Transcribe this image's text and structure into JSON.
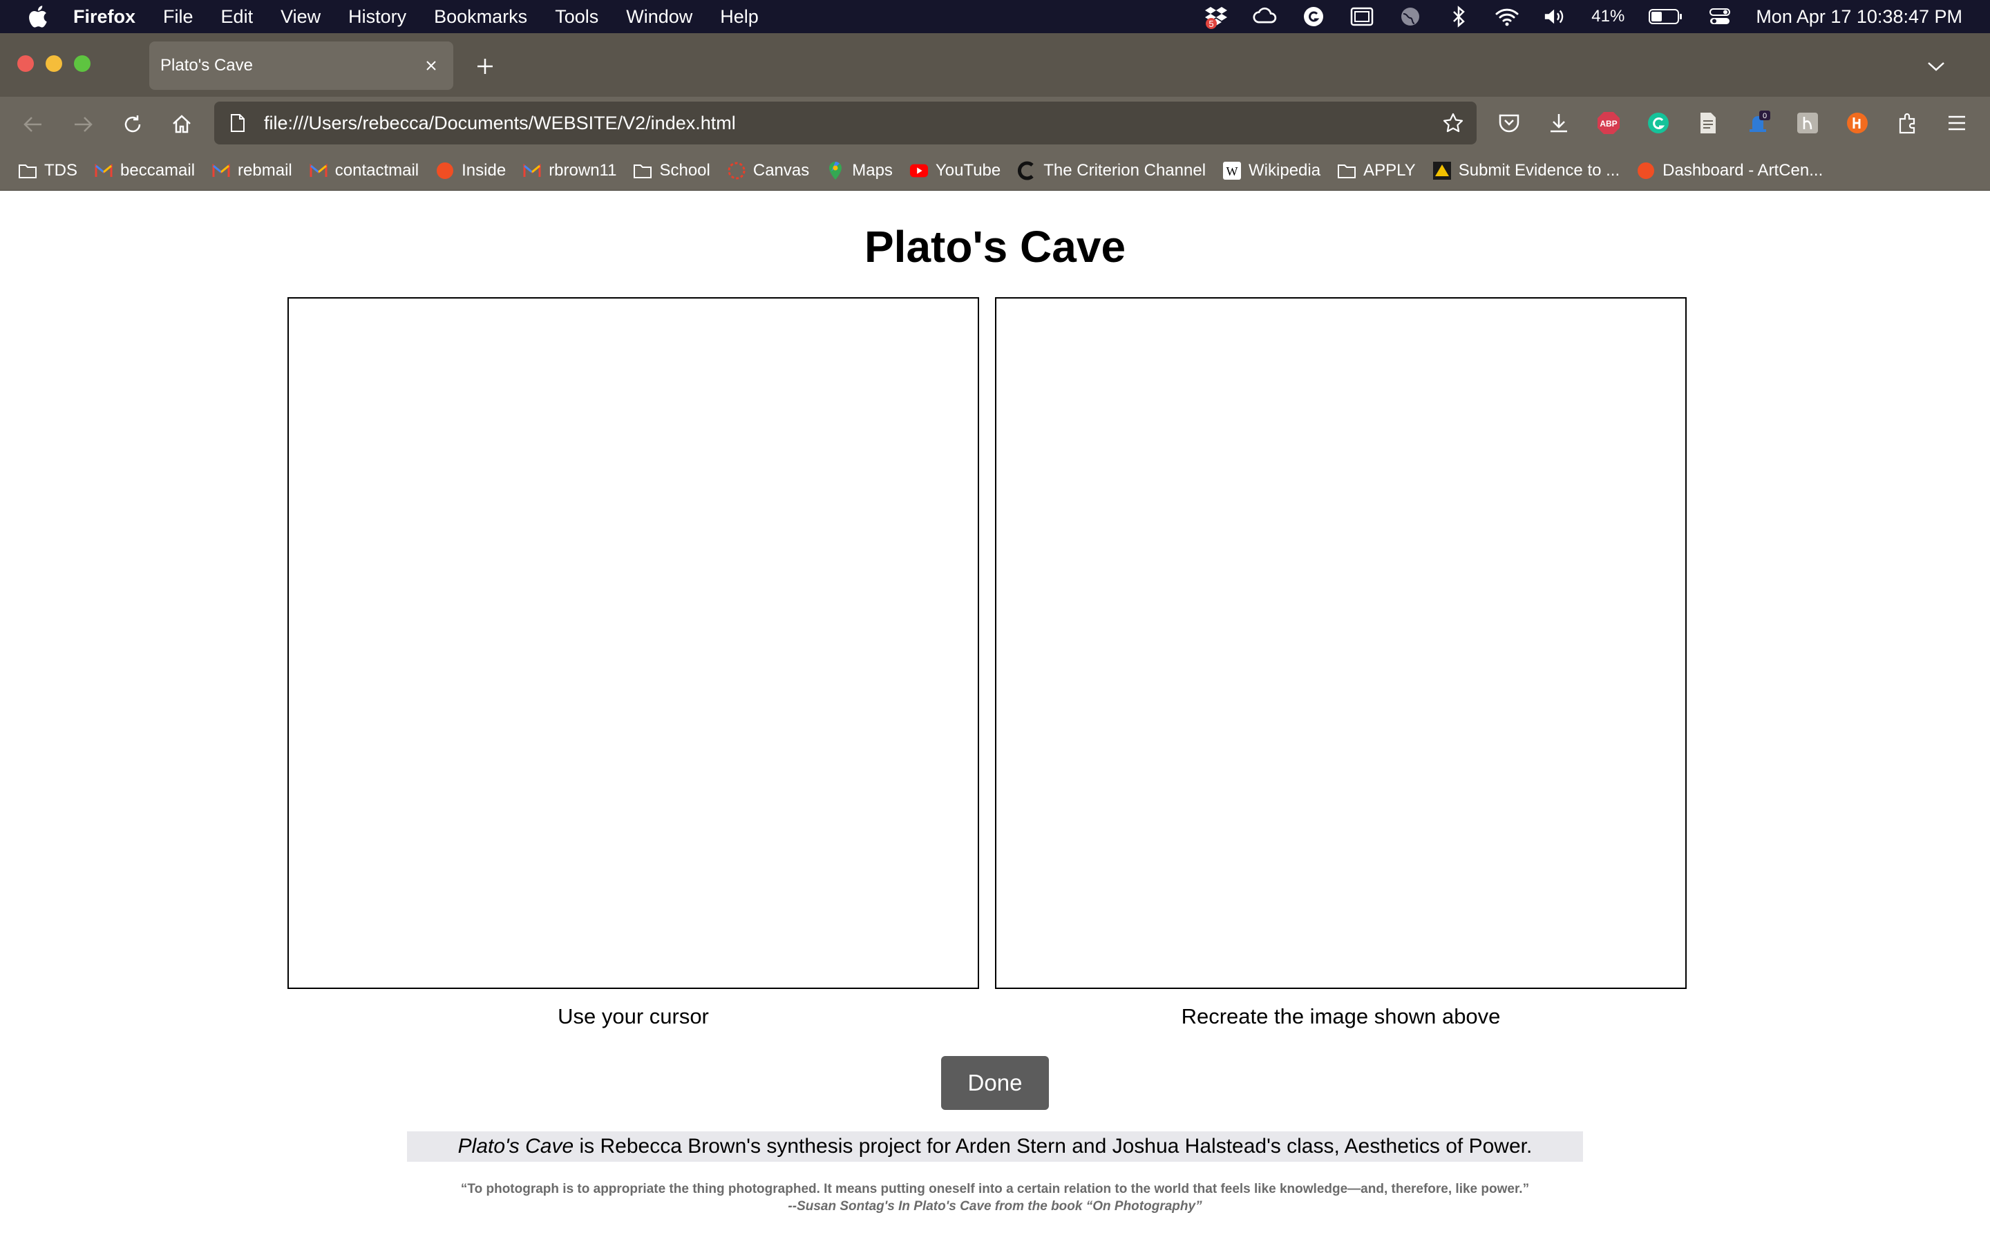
{
  "menubar": {
    "app_name": "Firefox",
    "items": [
      "File",
      "Edit",
      "View",
      "History",
      "Bookmarks",
      "Tools",
      "Window",
      "Help"
    ],
    "dropbox_badge": "5",
    "battery_percent": "41%",
    "clock": "Mon Apr 17  10:38:47 PM"
  },
  "browser": {
    "tab_title": "Plato's Cave",
    "url": "file:///Users/rebecca/Documents/WEBSITE/V2/index.html",
    "extension_badge": "0",
    "abp_label": "ABP",
    "bookmarks": [
      {
        "label": "TDS",
        "icon": "folder-icon"
      },
      {
        "label": "beccamail",
        "icon": "gmail-icon"
      },
      {
        "label": "rebmail",
        "icon": "gmail-icon"
      },
      {
        "label": "contactmail",
        "icon": "gmail-icon"
      },
      {
        "label": "Inside",
        "icon": "inside-icon"
      },
      {
        "label": "rbrown11",
        "icon": "gmail-icon"
      },
      {
        "label": "School",
        "icon": "folder-icon"
      },
      {
        "label": "Canvas",
        "icon": "canvas-icon"
      },
      {
        "label": "Maps",
        "icon": "maps-icon"
      },
      {
        "label": "YouTube",
        "icon": "youtube-icon"
      },
      {
        "label": "The Criterion Channel",
        "icon": "criterion-icon"
      },
      {
        "label": "Wikipedia",
        "icon": "wikipedia-icon"
      },
      {
        "label": "APPLY",
        "icon": "folder-icon"
      },
      {
        "label": "Submit Evidence to ...",
        "icon": "warning-icon"
      },
      {
        "label": "Dashboard - ArtCen...",
        "icon": "artcenter-icon"
      }
    ]
  },
  "page": {
    "title": "Plato's Cave",
    "left_caption": "Use your cursor",
    "right_caption": "Recreate the image shown above",
    "done_label": "Done",
    "credit_em": "Plato's Cave",
    "credit_rest": " is Rebecca Brown's synthesis project for Arden Stern and Joshua Halstead's class, Aesthetics of Power.",
    "quote": "“To photograph is to appropriate the thing photographed. It means putting oneself into a certain relation to the world that feels like knowledge—and, therefore, like power.”",
    "quote_attribution": "--Susan Sontag's In Plato's Cave from the book “On Photography”"
  },
  "colors": {
    "menubar_bg": "#15152b",
    "chrome_bg": "#5a554c",
    "toolbar_bg": "#6b665d",
    "urlbar_bg": "#4a463f",
    "done_button_bg": "#5c5c5c",
    "credit_bg": "#e8e8ec"
  }
}
